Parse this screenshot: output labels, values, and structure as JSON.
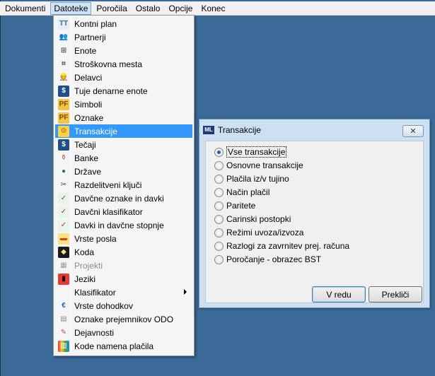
{
  "menubar": {
    "items": [
      {
        "label": "Dokumenti",
        "active": false
      },
      {
        "label": "Datoteke",
        "active": true
      },
      {
        "label": "Poročila",
        "active": false
      },
      {
        "label": "Ostalo",
        "active": false
      },
      {
        "label": "Opcije",
        "active": false
      },
      {
        "label": "Konec",
        "active": false
      }
    ]
  },
  "dropdown": {
    "items": [
      {
        "label": "Kontni plan",
        "icon": "kontni-plan-icon",
        "glyph": "TT",
        "color": "#3a6ea5",
        "bg": "#e8eef6"
      },
      {
        "label": "Partnerji",
        "icon": "partners-icon",
        "glyph": "👥",
        "color": "#b5502a",
        "bg": "transparent"
      },
      {
        "label": "Enote",
        "icon": "units-icon",
        "glyph": "⊞",
        "color": "#555555",
        "bg": "transparent"
      },
      {
        "label": "Stroškovna mesta",
        "icon": "cost-centers-icon",
        "glyph": "⌗",
        "color": "#555555",
        "bg": "transparent"
      },
      {
        "label": "Delavci",
        "icon": "workers-icon",
        "glyph": "👷",
        "color": "#2f5fa5",
        "bg": "transparent"
      },
      {
        "label": "Tuje denarne enote",
        "icon": "foreign-currency-icon",
        "glyph": "$",
        "color": "#ffffff",
        "bg": "#1f4f8a"
      },
      {
        "label": "Simboli",
        "icon": "symbols-icon",
        "glyph": "PF",
        "color": "#7a4b00",
        "bg": "#f4c542"
      },
      {
        "label": "Oznake",
        "icon": "labels-icon",
        "glyph": "PF",
        "color": "#7a4b00",
        "bg": "#f4c542"
      },
      {
        "label": "Transakcije",
        "icon": "transactions-icon",
        "glyph": "⚙",
        "color": "#b07000",
        "bg": "#ffd24a",
        "selected": true
      },
      {
        "label": "Tečaji",
        "icon": "exchange-rates-icon",
        "glyph": "$",
        "color": "#ffffff",
        "bg": "#1f4f8a"
      },
      {
        "label": "Banke",
        "icon": "banks-icon",
        "glyph": "⚱",
        "color": "#c0504d",
        "bg": "transparent"
      },
      {
        "label": "Države",
        "icon": "countries-icon",
        "glyph": "●",
        "color": "#2e7d32",
        "bg": "transparent"
      },
      {
        "label": "Razdelitveni ključi",
        "icon": "distribution-keys-icon",
        "glyph": "✂",
        "color": "#444444",
        "bg": "transparent"
      },
      {
        "label": "Davčne oznake in davki",
        "icon": "tax-labels-icon",
        "glyph": "✓",
        "color": "#c62828",
        "bg": "#e8f5e9"
      },
      {
        "label": "Davčni klasifikator",
        "icon": "tax-classifier-icon",
        "glyph": "✓",
        "color": "#c62828",
        "bg": "#e8f5e9"
      },
      {
        "label": "Davki in davčne stopnje",
        "icon": "tax-rates-icon",
        "glyph": "✓",
        "color": "#c62828",
        "bg": "#e8f5e9"
      },
      {
        "label": "Vrste posla",
        "icon": "business-types-icon",
        "glyph": "▬",
        "color": "#d84315",
        "bg": "#ffe082"
      },
      {
        "label": "Koda",
        "icon": "code-icon",
        "glyph": "◆",
        "color": "#f0e68c",
        "bg": "#1b1b1b"
      },
      {
        "label": "Projekti",
        "icon": "projects-icon",
        "glyph": "▦",
        "color": "#9e9e9e",
        "bg": "transparent",
        "disabled": true
      },
      {
        "label": "Jeziki",
        "icon": "languages-icon",
        "glyph": "▮",
        "color": "#000000",
        "bg": "#e53935"
      },
      {
        "label": "Klasifikator",
        "icon": "classifier-icon",
        "glyph": "",
        "color": "#000000",
        "bg": "transparent",
        "submenu": true
      },
      {
        "label": "Vrste dohodkov",
        "icon": "income-types-icon",
        "glyph": "€",
        "color": "#1565c0",
        "bg": "transparent"
      },
      {
        "label": "Oznake prejemnikov ODO",
        "icon": "recipient-labels-icon",
        "glyph": "▤",
        "color": "#8d8d8d",
        "bg": "transparent"
      },
      {
        "label": "Dejavnosti",
        "icon": "activities-icon",
        "glyph": "✎",
        "color": "#c0504d",
        "bg": "transparent"
      },
      {
        "label": "Kode namena plačila",
        "icon": "payment-purpose-icon",
        "glyph": "▥",
        "color": "#ffffff",
        "bg": "linear-gradient(90deg,#e53935,#fbc02d,#43a047,#1e88e5)"
      }
    ]
  },
  "dialog": {
    "title": "Transakcije",
    "app_icon": "ML",
    "close_glyph": "✕",
    "options": [
      {
        "label": "Vse transakcije",
        "checked": true
      },
      {
        "label": "Osnovne transakcije",
        "checked": false
      },
      {
        "label": "Plačila iz/v tujino",
        "checked": false
      },
      {
        "label": "Način plačil",
        "checked": false
      },
      {
        "label": "Paritete",
        "checked": false
      },
      {
        "label": "Carinski postopki",
        "checked": false
      },
      {
        "label": "Režimi uvoza/izvoza",
        "checked": false
      },
      {
        "label": "Razlogi za zavrnitev prej. računa",
        "checked": false
      },
      {
        "label": "Poročanje - obrazec BST",
        "checked": false
      }
    ],
    "ok_label": "V redu",
    "cancel_label": "Prekliči"
  }
}
